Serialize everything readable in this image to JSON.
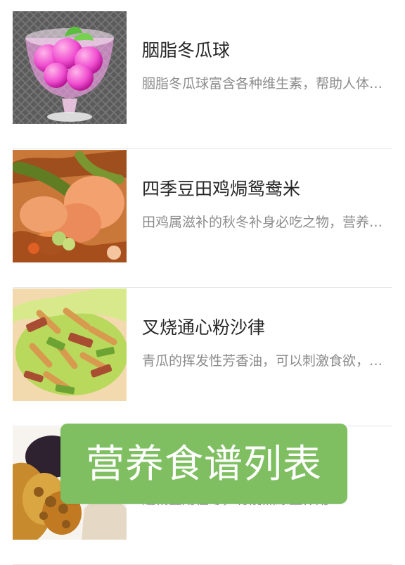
{
  "recipes": [
    {
      "title": "胭脂冬瓜球",
      "description": "胭脂冬瓜球富含各种维生素，帮助人体补充营养",
      "image_icon": "rouge-winter-melon-balls-photo"
    },
    {
      "title": "四季豆田鸡焗鸳鸯米",
      "description": "田鸡属滋补的秋冬补身必吃之物，营养丰富",
      "image_icon": "green-bean-frog-rice-photo"
    },
    {
      "title": "叉烧通心粉沙律",
      "description": "青瓜的挥发性芳香油，可以刺激食欲，清爽可口",
      "image_icon": "char-siu-macaroni-salad-photo"
    },
    {
      "title": "",
      "description": "适精宜用性冬，有削煎冻益作用…",
      "image_icon": "lotus-root-dish-photo"
    }
  ],
  "banner": {
    "text": "营养食谱列表"
  },
  "colors": {
    "banner_bg": "#7fbf62",
    "title": "#262626",
    "description": "#8c8c8c",
    "divider": "#e6e6e6"
  }
}
